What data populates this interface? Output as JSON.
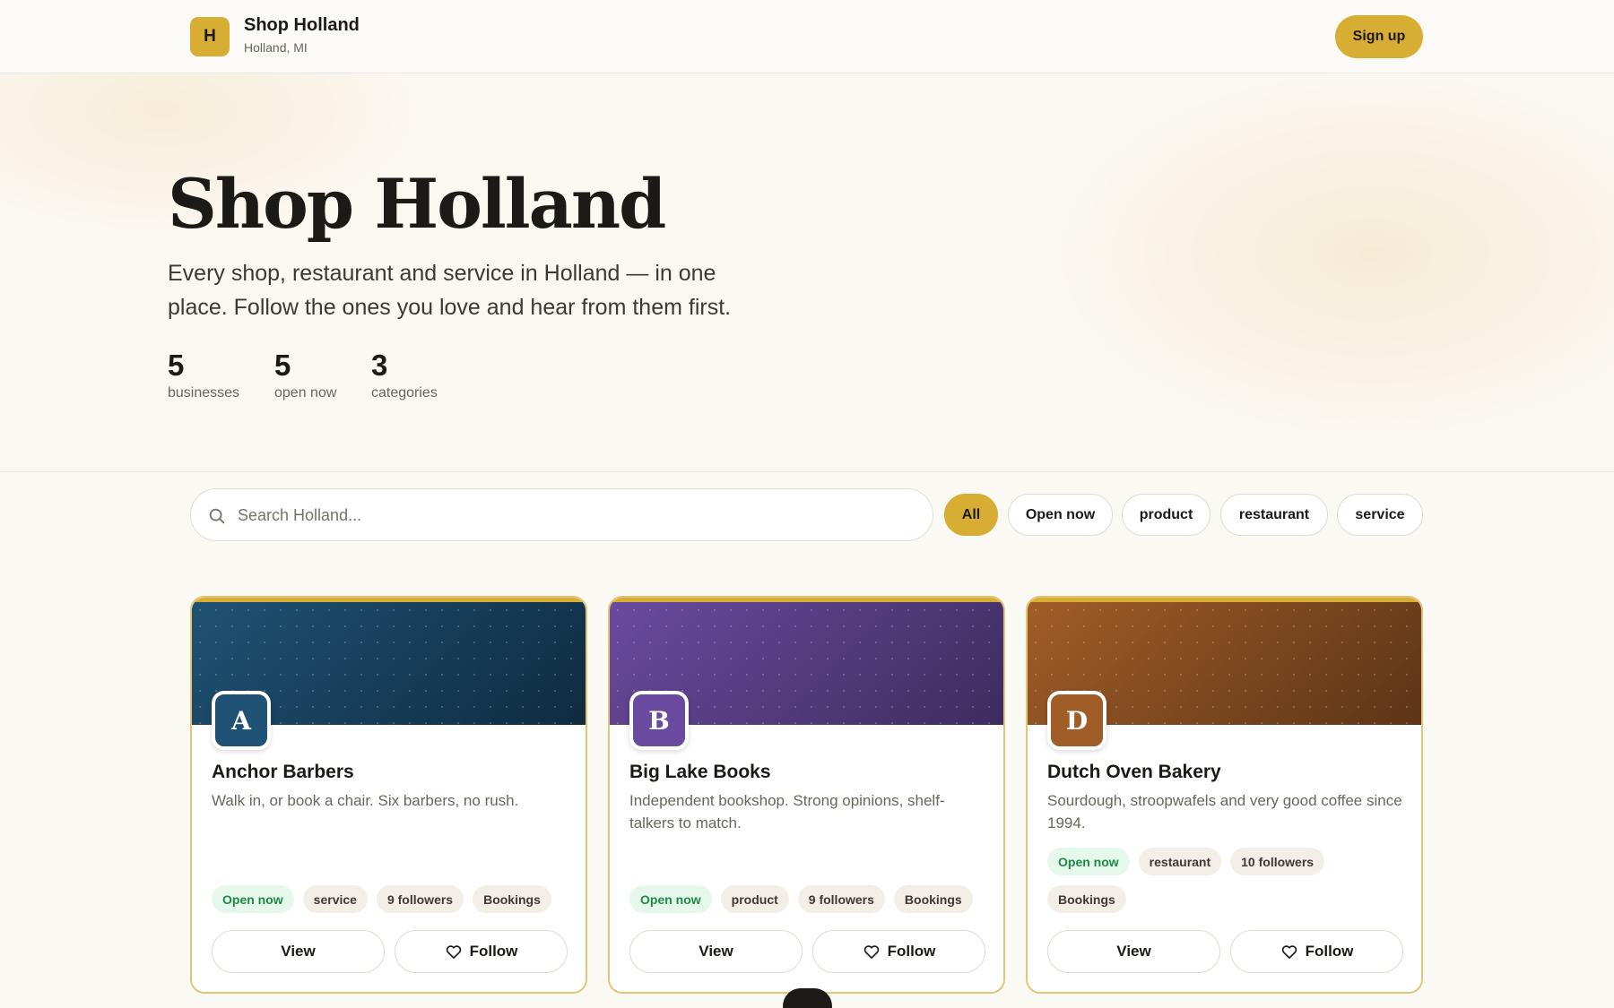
{
  "header": {
    "logo_letter": "H",
    "brand_name": "Shop Holland",
    "location": "Holland, MI",
    "signup_label": "Sign up"
  },
  "hero": {
    "title": "Shop Holland",
    "subtitle": "Every shop, restaurant and service in Holland — in one place. Follow the ones you love and hear from them first.",
    "stats": [
      {
        "value": "5",
        "label": "businesses"
      },
      {
        "value": "5",
        "label": "open now"
      },
      {
        "value": "3",
        "label": "categories"
      }
    ]
  },
  "search": {
    "placeholder": "Search Holland...",
    "icon": "search-icon"
  },
  "filters": [
    {
      "label": "All",
      "active": true
    },
    {
      "label": "Open now",
      "active": false
    },
    {
      "label": "product",
      "active": false
    },
    {
      "label": "restaurant",
      "active": false
    },
    {
      "label": "service",
      "active": false
    }
  ],
  "cards": [
    {
      "initial": "A",
      "name": "Anchor Barbers",
      "description": "Walk in, or book a chair. Six barbers, no rush.",
      "tags": [
        "Open now",
        "service",
        "9 followers",
        "Bookings"
      ],
      "view_label": "View",
      "follow_label": "Follow",
      "color": "#1f5274",
      "color_dark": "#0f2b40"
    },
    {
      "initial": "B",
      "name": "Big Lake Books",
      "description": "Independent bookshop. Strong opinions, shelf-talkers to match.",
      "tags": [
        "Open now",
        "product",
        "9 followers",
        "Bookings"
      ],
      "view_label": "View",
      "follow_label": "Follow",
      "color": "#6a4a9e",
      "color_dark": "#3d2c5e"
    },
    {
      "initial": "D",
      "name": "Dutch Oven Bakery",
      "description": "Sourdough, stroopwafels and very good coffee since 1994.",
      "tags": [
        "Open now",
        "restaurant",
        "10 followers",
        "Bookings"
      ],
      "view_label": "View",
      "follow_label": "Follow",
      "color": "#a15d28",
      "color_dark": "#5c3416"
    }
  ],
  "colors": {
    "accent": "#d7ad34",
    "open_green": "#1f8a44"
  }
}
